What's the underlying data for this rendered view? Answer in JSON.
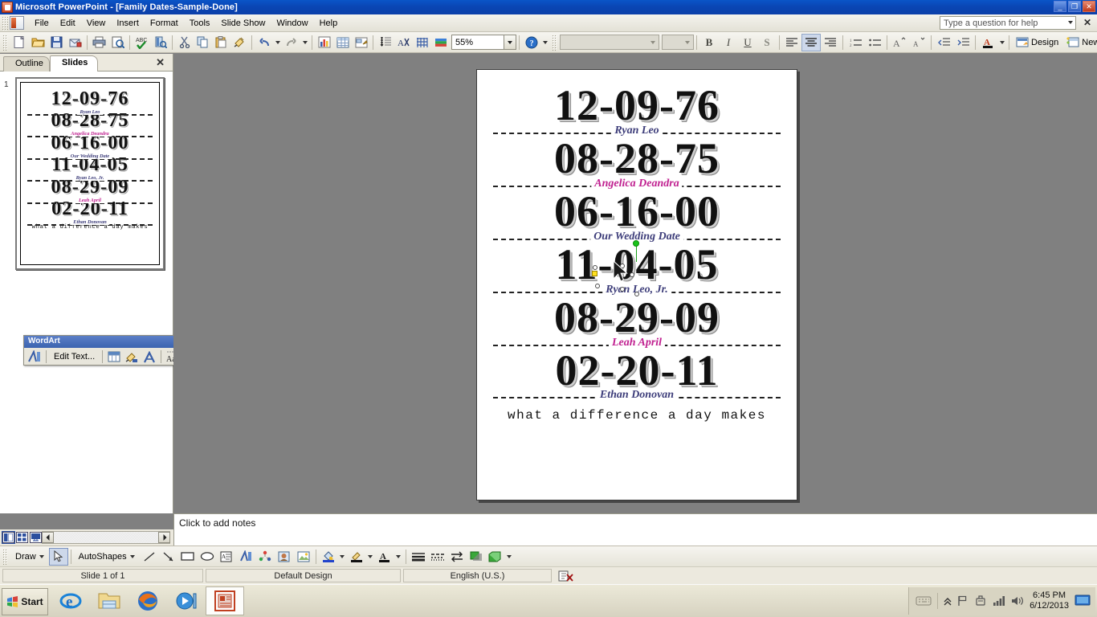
{
  "window": {
    "title": "Microsoft PowerPoint - [Family Dates-Sample-Done]",
    "app_icon": "powerpoint-icon",
    "minimize": "_",
    "restore": "❐",
    "close": "✕"
  },
  "menubar": {
    "items": [
      {
        "label": "File"
      },
      {
        "label": "Edit"
      },
      {
        "label": "View"
      },
      {
        "label": "Insert"
      },
      {
        "label": "Format"
      },
      {
        "label": "Tools"
      },
      {
        "label": "Slide Show"
      },
      {
        "label": "Window"
      },
      {
        "label": "Help"
      }
    ],
    "help_placeholder": "Type a question for help",
    "close_label": "✕"
  },
  "toolbar": {
    "zoom_value": "55%",
    "design_label": "Design",
    "new_slide_label": "New Slide",
    "buttons": [
      "new-document-icon",
      "open-folder-icon",
      "save-icon",
      "email-icon",
      "print-icon",
      "print-preview-icon",
      "spell-check-icon",
      "research-icon",
      "cut-icon",
      "copy-icon",
      "paste-icon",
      "format-painter-icon",
      "undo-icon",
      "redo-icon",
      "insert-chart-icon",
      "insert-table-icon",
      "insert-diagram-icon",
      "show-formatting-icon",
      "expand-all-icon",
      "show-grid-icon",
      "color-scheme-icon",
      "help-icon"
    ],
    "font_name": "",
    "font_size": "",
    "bold_label": "B",
    "italic_label": "I",
    "underline_label": "U",
    "shadow_label": "S",
    "align_left": "align-left-icon",
    "align_center": "align-center-icon",
    "align_right": "align-right-icon",
    "numbering": "numbered-list-icon",
    "bullets": "bulleted-list-icon",
    "increase_font": "A",
    "decrease_font": "A",
    "decrease_indent": "decrease-indent-icon",
    "increase_indent": "increase-indent-icon",
    "font_color": "A"
  },
  "leftpane": {
    "tabs": [
      {
        "label": "Outline",
        "selected": false
      },
      {
        "label": "Slides",
        "selected": true
      }
    ],
    "close_label": "✕",
    "thumbnail_number": "1"
  },
  "wordart_toolbar": {
    "title": "WordArt",
    "dropdown": "▾",
    "close": "✕",
    "edit_text_label": "Edit Text...",
    "buttons": [
      "insert-wordart-icon",
      "wordart-gallery-icon",
      "format-wordart-icon",
      "wordart-shape-icon",
      "wordart-same-letter-heights-icon",
      "wordart-vertical-text-icon",
      "wordart-alignment-icon",
      "wordart-character-spacing-icon"
    ]
  },
  "slide": {
    "rows": [
      {
        "date": "12-09-76",
        "name": "Ryan Leo",
        "name_color": "navy"
      },
      {
        "date": "08-28-75",
        "name": "Angelica Deandra",
        "name_color": "pink"
      },
      {
        "date": "06-16-00",
        "name": "Our Wedding Date",
        "name_color": "navy"
      },
      {
        "date": "11-04-05",
        "name": "Ryan Leo, Jr.",
        "name_color": "navy"
      },
      {
        "date": "08-29-09",
        "name": "Leah April",
        "name_color": "pink"
      },
      {
        "date": "02-20-11",
        "name": "Ethan Donovan",
        "name_color": "navy"
      }
    ],
    "tagline": "what a difference a day makes",
    "colors": {
      "name_navy": "#3d3d7a",
      "name_pink": "#c02090",
      "rotation_handle": "#19c419",
      "adjust_handle": "#ffe020"
    }
  },
  "notes": {
    "placeholder": "Click to add notes"
  },
  "viewbar": {
    "buttons": [
      "normal-view-icon",
      "slide-sorter-view-icon",
      "slide-show-view-icon"
    ]
  },
  "drawbar": {
    "draw_label": "Draw",
    "autoshapes_label": "AutoShapes",
    "buttons": [
      "select-objects-icon",
      "line-icon",
      "arrow-icon",
      "rectangle-icon",
      "oval-icon",
      "text-box-icon",
      "insert-wordart-icon",
      "insert-diagram-icon",
      "insert-clip-art-icon",
      "insert-picture-icon",
      "fill-color-icon",
      "line-color-icon",
      "font-color-icon",
      "line-style-icon",
      "dash-style-icon",
      "arrow-style-icon",
      "shadow-style-icon",
      "3d-style-icon"
    ]
  },
  "statusbar": {
    "slide_indicator": "Slide 1 of 1",
    "design_name": "Default Design",
    "language": "English (U.S.)",
    "spelling_icon": "spelling-status-icon"
  },
  "taskbar": {
    "start_label": "Start",
    "apps": [
      {
        "name": "internet-explorer-icon",
        "active": false
      },
      {
        "name": "windows-explorer-icon",
        "active": false
      },
      {
        "name": "firefox-icon",
        "active": false
      },
      {
        "name": "media-player-icon",
        "active": false
      },
      {
        "name": "powerpoint-icon",
        "active": true
      }
    ],
    "tray": [
      "keyboard-icon",
      "show-hidden-icons-icon",
      "flag-icon",
      "safely-remove-hardware-icon",
      "network-icon",
      "volume-icon"
    ],
    "time": "6:45 PM",
    "date": "6/12/2013",
    "show_desktop": "show-desktop-icon"
  }
}
